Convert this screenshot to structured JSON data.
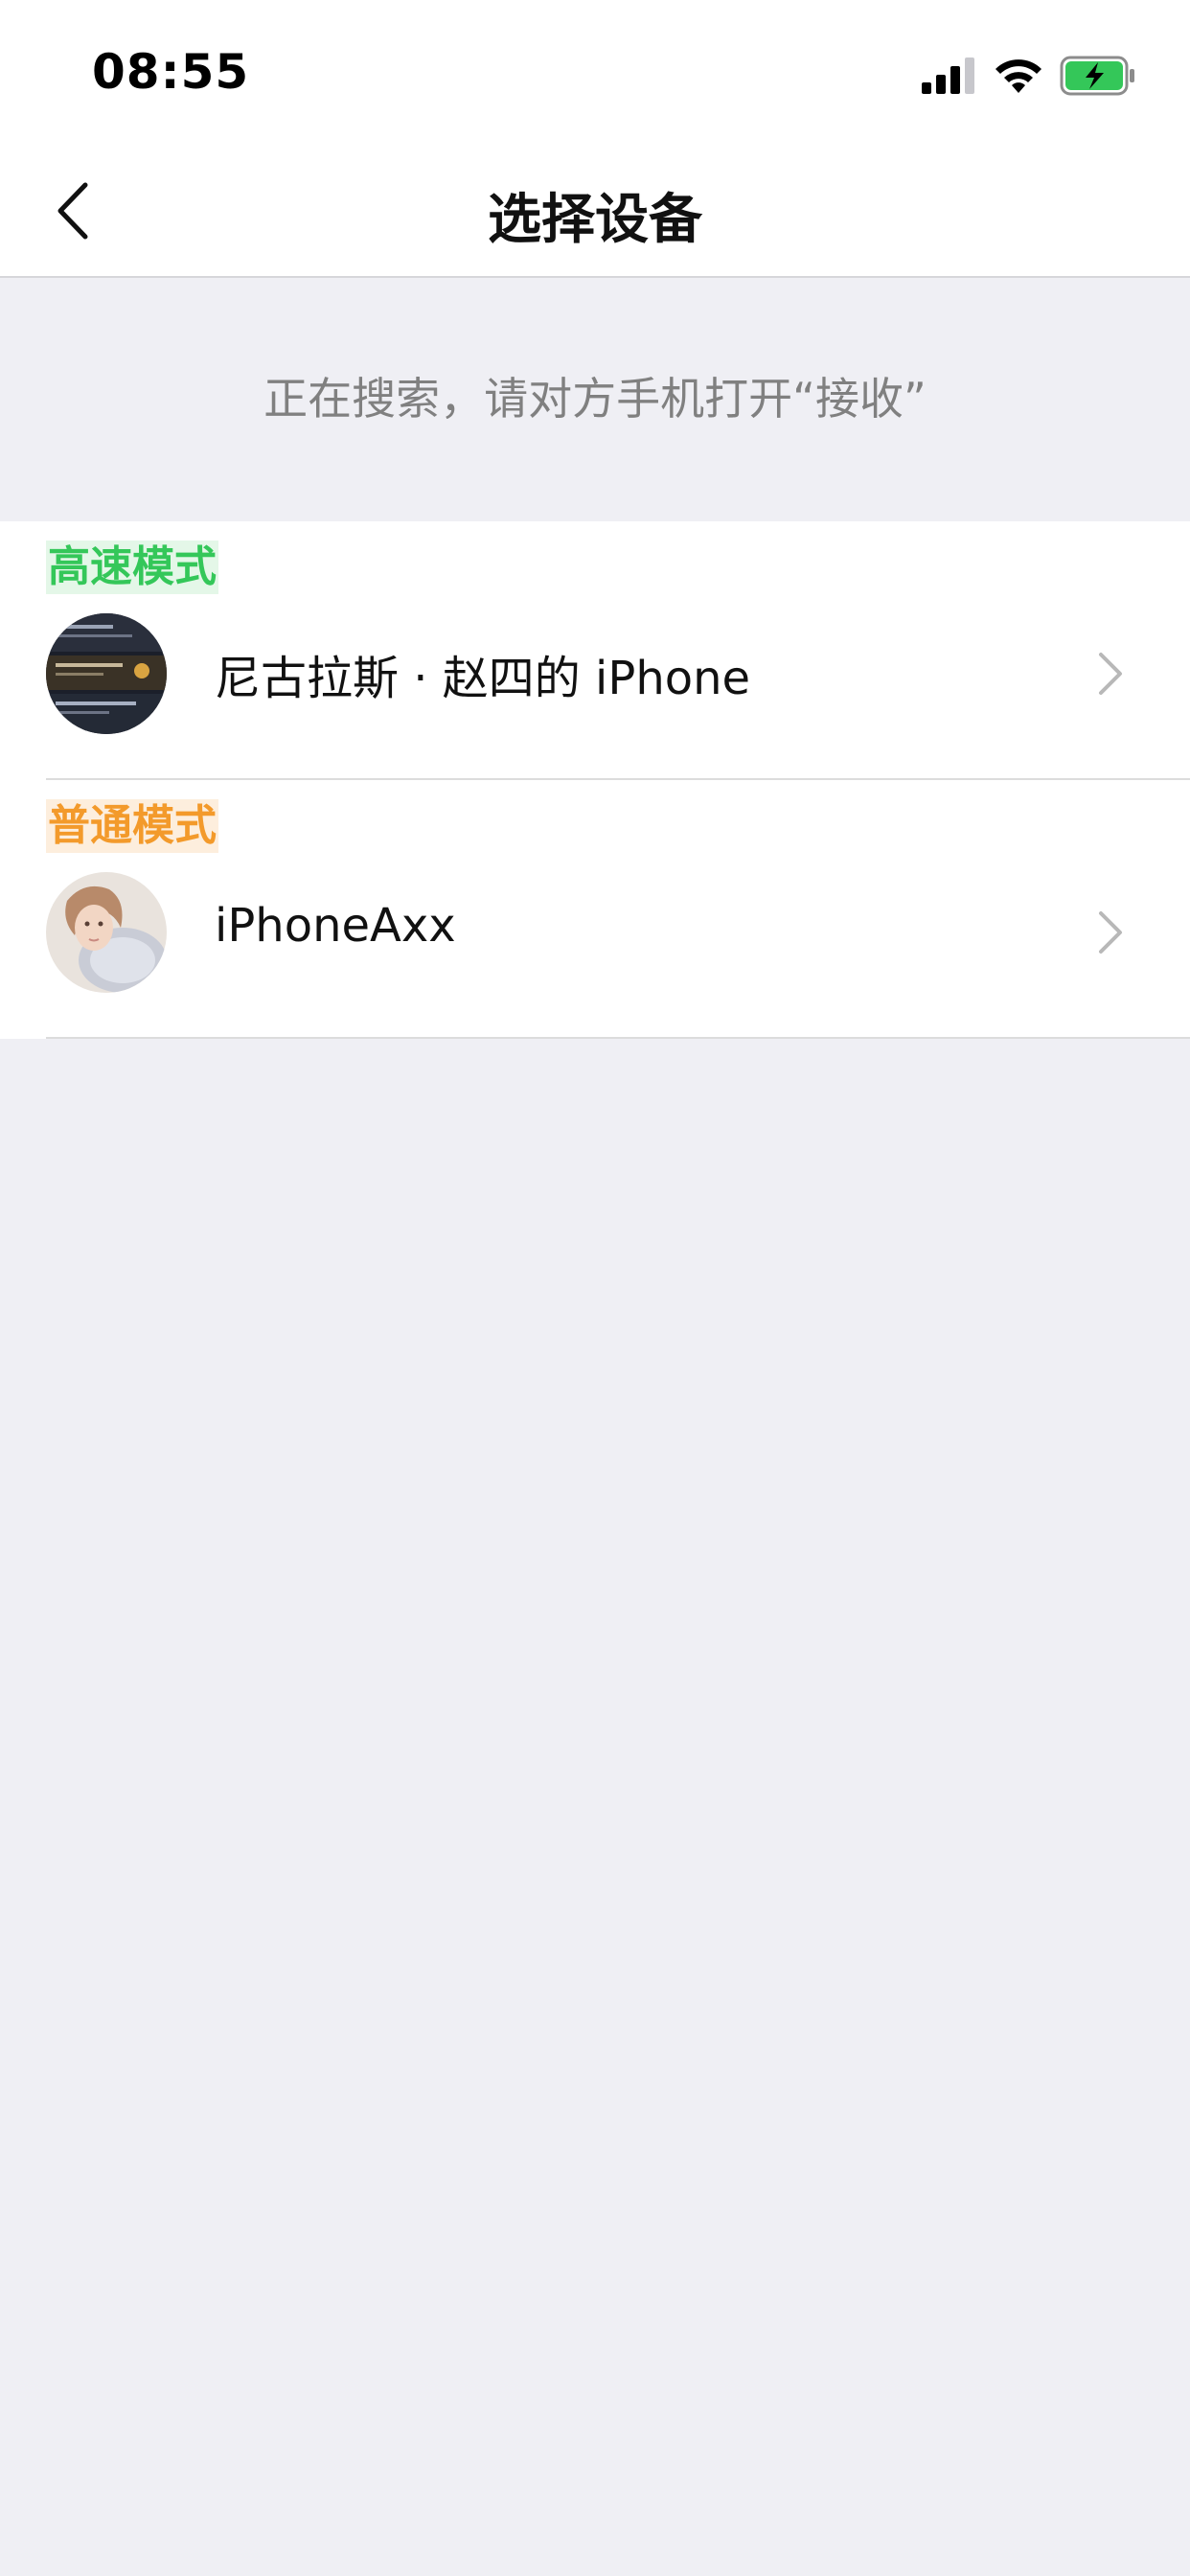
{
  "status_bar": {
    "time": "08:55",
    "icons": [
      "cellular-signal-icon",
      "wifi-icon",
      "battery-charging-icon"
    ]
  },
  "nav": {
    "title": "选择设备",
    "back_icon": "chevron-left-icon"
  },
  "hint": "正在搜索，请对方手机打开“接收”",
  "devices": [
    {
      "mode": "高速模式",
      "mode_color": "#34c759",
      "mode_bg": "#e4f7e8",
      "name": "尼古拉斯 · 赵四的 iPhone",
      "avatar_icon": "dark-screenshot-avatar"
    },
    {
      "mode": "普通模式",
      "mode_color": "#f39a2b",
      "mode_bg": "#fdeedd",
      "name": "iPhoneAxx",
      "avatar_icon": "person-photo-avatar"
    }
  ],
  "colors": {
    "background": "#efeff4",
    "chevron": "#b8b8b8"
  }
}
